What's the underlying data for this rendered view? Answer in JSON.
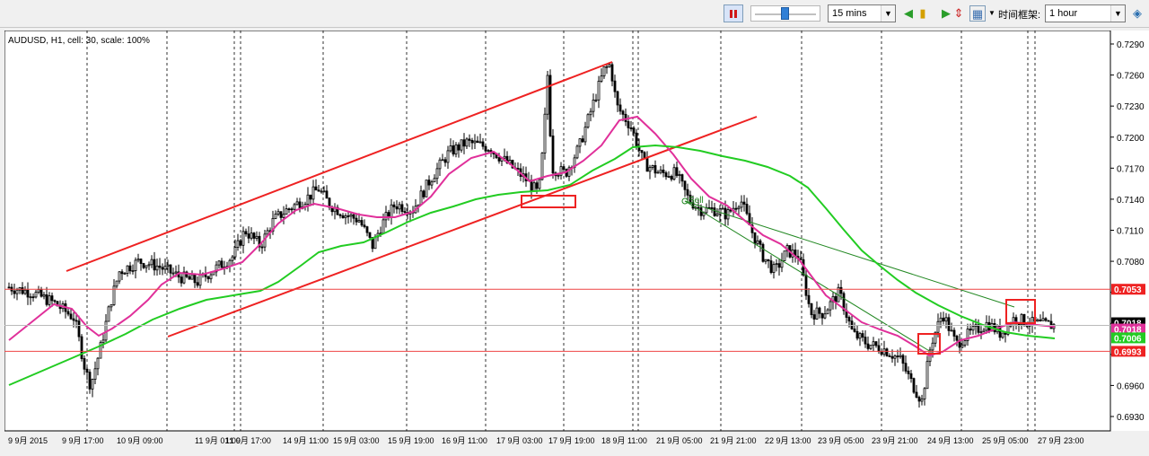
{
  "toolbar": {
    "timeframe_value": "15 mins",
    "timeframe_label": "时间框架:",
    "period_value": "1 hour"
  },
  "chart": {
    "info": "AUDUSD, H1, cell: 30, scale: 100%",
    "sell_label": "Sell",
    "price_ticks": [
      0.729,
      0.726,
      0.723,
      0.72,
      0.717,
      0.714,
      0.711,
      0.708,
      0.705,
      0.702,
      0.699,
      0.696,
      0.693
    ],
    "price_tick_labels": [
      "0.7290",
      "0.7260",
      "0.7230",
      "0.7200",
      "0.7170",
      "0.7140",
      "0.7110",
      "0.7080",
      "",
      "",
      "",
      "0.6960",
      "0.6930"
    ],
    "time_labels": [
      "9 9月 2015",
      "9 9月 17:00",
      "10 9月 09:00",
      "11 9月 01:00",
      "11 9月 17:00",
      "14 9月 11:00",
      "15 9月 03:00",
      "15 9月 19:00",
      "16 9月 11:00",
      "17 9月 03:00",
      "17 9月 19:00",
      "18 9月 11:00",
      "21 9月 05:00",
      "21 9月 21:00",
      "22 9月 13:00",
      "23 9月 05:00",
      "23 9月 21:00",
      "24 9月 13:00",
      "25 9月 05:00",
      "27 9月 23:00"
    ],
    "price_badges": [
      {
        "value": "0.7053",
        "color": "#ee2222",
        "text_color": "#ffffff"
      },
      {
        "value": "0.7018",
        "color": "#000000",
        "text_color": "#ffffff"
      },
      {
        "value": "0.7018",
        "color": "#e0309a",
        "text_color": "#ffffff"
      },
      {
        "value": "0.7006",
        "color": "#22cc22",
        "text_color": "#ffffff"
      },
      {
        "value": "0.6993",
        "color": "#ee2222",
        "text_color": "#ffffff"
      }
    ],
    "colors": {
      "candle": "#000000",
      "fast_ma": "#e0309a",
      "slow_ma": "#22cc22",
      "channel": "#ee2222",
      "trend": "#228822"
    }
  }
}
